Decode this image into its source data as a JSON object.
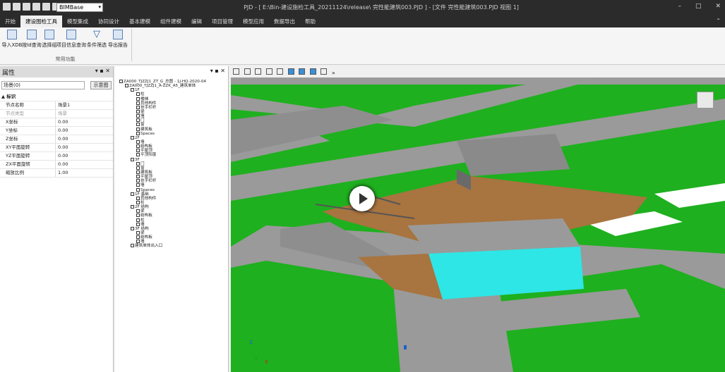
{
  "titlebar": {
    "combo_value": "BIMBase",
    "title": "PJD - [ E:\\Bin-建设施检工具_20211124\\release\\ 完性能建筑003.PJD ] - [文件 完性能建筑003.PJD 视图 1]",
    "minimize": "–",
    "maximize": "□",
    "close": "✕"
  },
  "menu": {
    "tabs": [
      "开始",
      "建设图检工具",
      "模型集成",
      "协同设计",
      "基本建模",
      "组件建模",
      "编辑",
      "项目管理",
      "模型应用",
      "数据导出",
      "帮助"
    ],
    "active_index": 1
  },
  "ribbon": {
    "buttons": [
      "导入XDB",
      "按Id查询",
      "选择组",
      "项目信息查询",
      "条件筛选",
      "导出报告"
    ],
    "group_label": "常用功能"
  },
  "properties_panel": {
    "title": "属性",
    "pin": "▾ ▪",
    "close": "✕",
    "scene_value": "场景(0)",
    "scene_button": "示意图",
    "section": "标识",
    "rows": [
      {
        "key": "节点名称",
        "value": "场景1",
        "disabled": false
      },
      {
        "key": "节点类型",
        "value": "场景",
        "disabled": true
      },
      {
        "key": "X坐标",
        "value": "0.00",
        "disabled": false
      },
      {
        "key": "Y坐标",
        "value": "0.00",
        "disabled": false
      },
      {
        "key": "Z坐标",
        "value": "0.00",
        "disabled": false
      },
      {
        "key": "XY平面旋转",
        "value": "0.00",
        "disabled": false
      },
      {
        "key": "YZ平面旋转",
        "value": "0.00",
        "disabled": false
      },
      {
        "key": "ZX平面旋转",
        "value": "0.00",
        "disabled": false
      },
      {
        "key": "缩放比例",
        "value": "1.00",
        "disabled": false
      }
    ]
  },
  "tree_panel": {
    "controls": "▾ ▪ ✕",
    "items": [
      {
        "label": "ZA000_TJZZJ1_ZT_G_总图 - 1J-HQ-2020-04",
        "depth": 0
      },
      {
        "label": "ZA000_TJZZJ1_A-ZZK_A5_建筑单体",
        "depth": 1
      },
      {
        "label": "1F",
        "depth": 2
      },
      {
        "label": "柱",
        "depth": 3
      },
      {
        "label": "楼梯",
        "depth": 3
      },
      {
        "label": "其他构件",
        "depth": 3
      },
      {
        "label": "扶手栏杆",
        "depth": 3
      },
      {
        "label": "梁",
        "depth": 3
      },
      {
        "label": "墙",
        "depth": 3
      },
      {
        "label": "门",
        "depth": 3
      },
      {
        "label": "窗",
        "depth": 3
      },
      {
        "label": "建筑板",
        "depth": 3
      },
      {
        "label": "Spaces",
        "depth": 3
      },
      {
        "label": "2F",
        "depth": 2
      },
      {
        "label": "墙",
        "depth": 3
      },
      {
        "label": "结构板",
        "depth": 3
      },
      {
        "label": "平屋顶",
        "depth": 3
      },
      {
        "label": "平顶阳蓬",
        "depth": 3
      },
      {
        "label": "3F",
        "depth": 2
      },
      {
        "label": "门",
        "depth": 3
      },
      {
        "label": "窗",
        "depth": 3
      },
      {
        "label": "建筑板",
        "depth": 3
      },
      {
        "label": "平屋顶",
        "depth": 3
      },
      {
        "label": "扶手栏杆",
        "depth": 3
      },
      {
        "label": "墙",
        "depth": 3
      },
      {
        "label": "Spaces",
        "depth": 3
      },
      {
        "label": "1F 基础",
        "depth": 2
      },
      {
        "label": "其他构件",
        "depth": 3
      },
      {
        "label": "柱",
        "depth": 3
      },
      {
        "label": "2F 结构",
        "depth": 2
      },
      {
        "label": "梁",
        "depth": 3
      },
      {
        "label": "结构板",
        "depth": 3
      },
      {
        "label": "柱",
        "depth": 3
      },
      {
        "label": "墙",
        "depth": 3
      },
      {
        "label": "3F 结构",
        "depth": 2
      },
      {
        "label": "梁",
        "depth": 3
      },
      {
        "label": "结构板",
        "depth": 3
      },
      {
        "label": "墙",
        "depth": 3
      },
      {
        "label": "建筑单体出入口",
        "depth": 2
      }
    ]
  },
  "viewport": {
    "colors": {
      "grass": "#1fb01f",
      "road": "#9a9a9a",
      "roof": "#a8743f",
      "facade": "#2ee6e6",
      "sky_white": "#ffffff"
    },
    "nav_cube": "view-cube-icon",
    "axis": {
      "z": "Z",
      "x": "X",
      "y": "Y"
    }
  }
}
